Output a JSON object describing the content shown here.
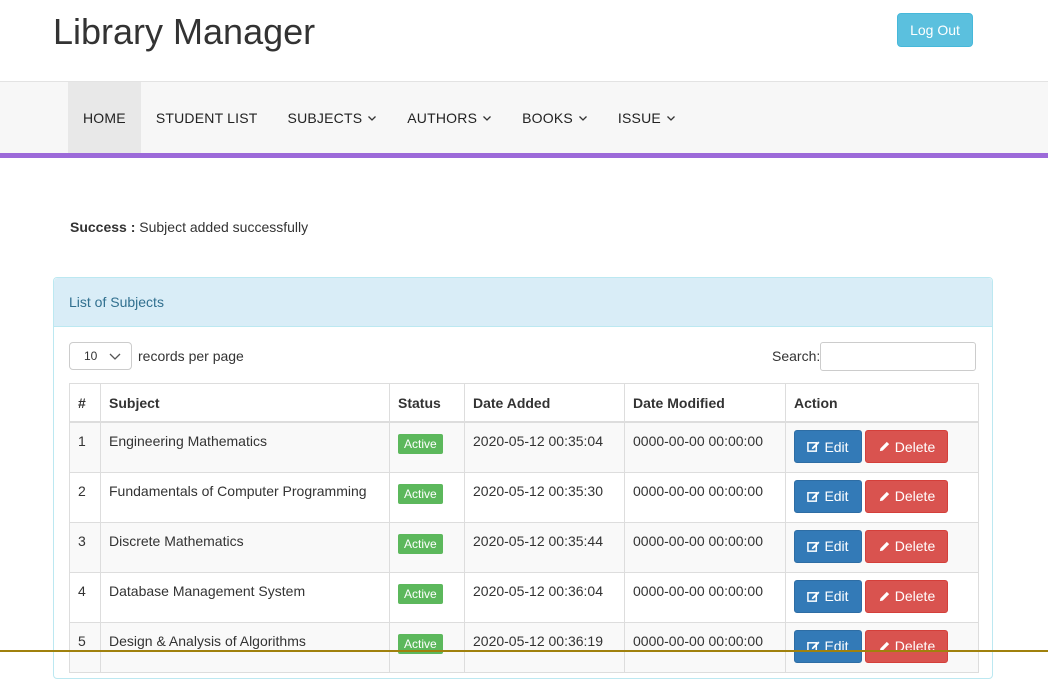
{
  "header": {
    "title": "Library Manager",
    "logout_label": "Log Out"
  },
  "nav": {
    "items": [
      {
        "label": "HOME",
        "has_dropdown": false,
        "active": true
      },
      {
        "label": "STUDENT LIST",
        "has_dropdown": false,
        "active": false
      },
      {
        "label": "SUBJECTS",
        "has_dropdown": true,
        "active": false
      },
      {
        "label": "AUTHORS",
        "has_dropdown": true,
        "active": false
      },
      {
        "label": "BOOKS",
        "has_dropdown": true,
        "active": false
      },
      {
        "label": "ISSUE",
        "has_dropdown": true,
        "active": false
      }
    ],
    "accent_color": "#9c6ad9"
  },
  "alert": {
    "label": "Success :",
    "message": "Subject added successfully"
  },
  "panel": {
    "title": "List of Subjects",
    "length_value": "10",
    "length_label": "records per page",
    "search_label": "Search:",
    "search_value": ""
  },
  "table": {
    "columns": [
      "#",
      "Subject",
      "Status",
      "Date Added",
      "Date Modified",
      "Action"
    ],
    "rows": [
      {
        "num": "1",
        "subject": "Engineering Mathematics",
        "status": "Active",
        "date_added": "2020-05-12 00:35:04",
        "date_modified": "0000-00-00 00:00:00"
      },
      {
        "num": "2",
        "subject": "Fundamentals of Computer Programming",
        "status": "Active",
        "date_added": "2020-05-12 00:35:30",
        "date_modified": "0000-00-00 00:00:00"
      },
      {
        "num": "3",
        "subject": "Discrete Mathematics",
        "status": "Active",
        "date_added": "2020-05-12 00:35:44",
        "date_modified": "0000-00-00 00:00:00"
      },
      {
        "num": "4",
        "subject": "Database Management System",
        "status": "Active",
        "date_added": "2020-05-12 00:36:04",
        "date_modified": "0000-00-00 00:00:00"
      },
      {
        "num": "5",
        "subject": "Design & Analysis of Algorithms",
        "status": "Active",
        "date_added": "2020-05-12 00:36:19",
        "date_modified": "0000-00-00 00:00:00"
      }
    ],
    "edit_label": "Edit",
    "delete_label": "Delete",
    "edit_icon": "edit-icon",
    "delete_icon": "pencil-icon"
  }
}
